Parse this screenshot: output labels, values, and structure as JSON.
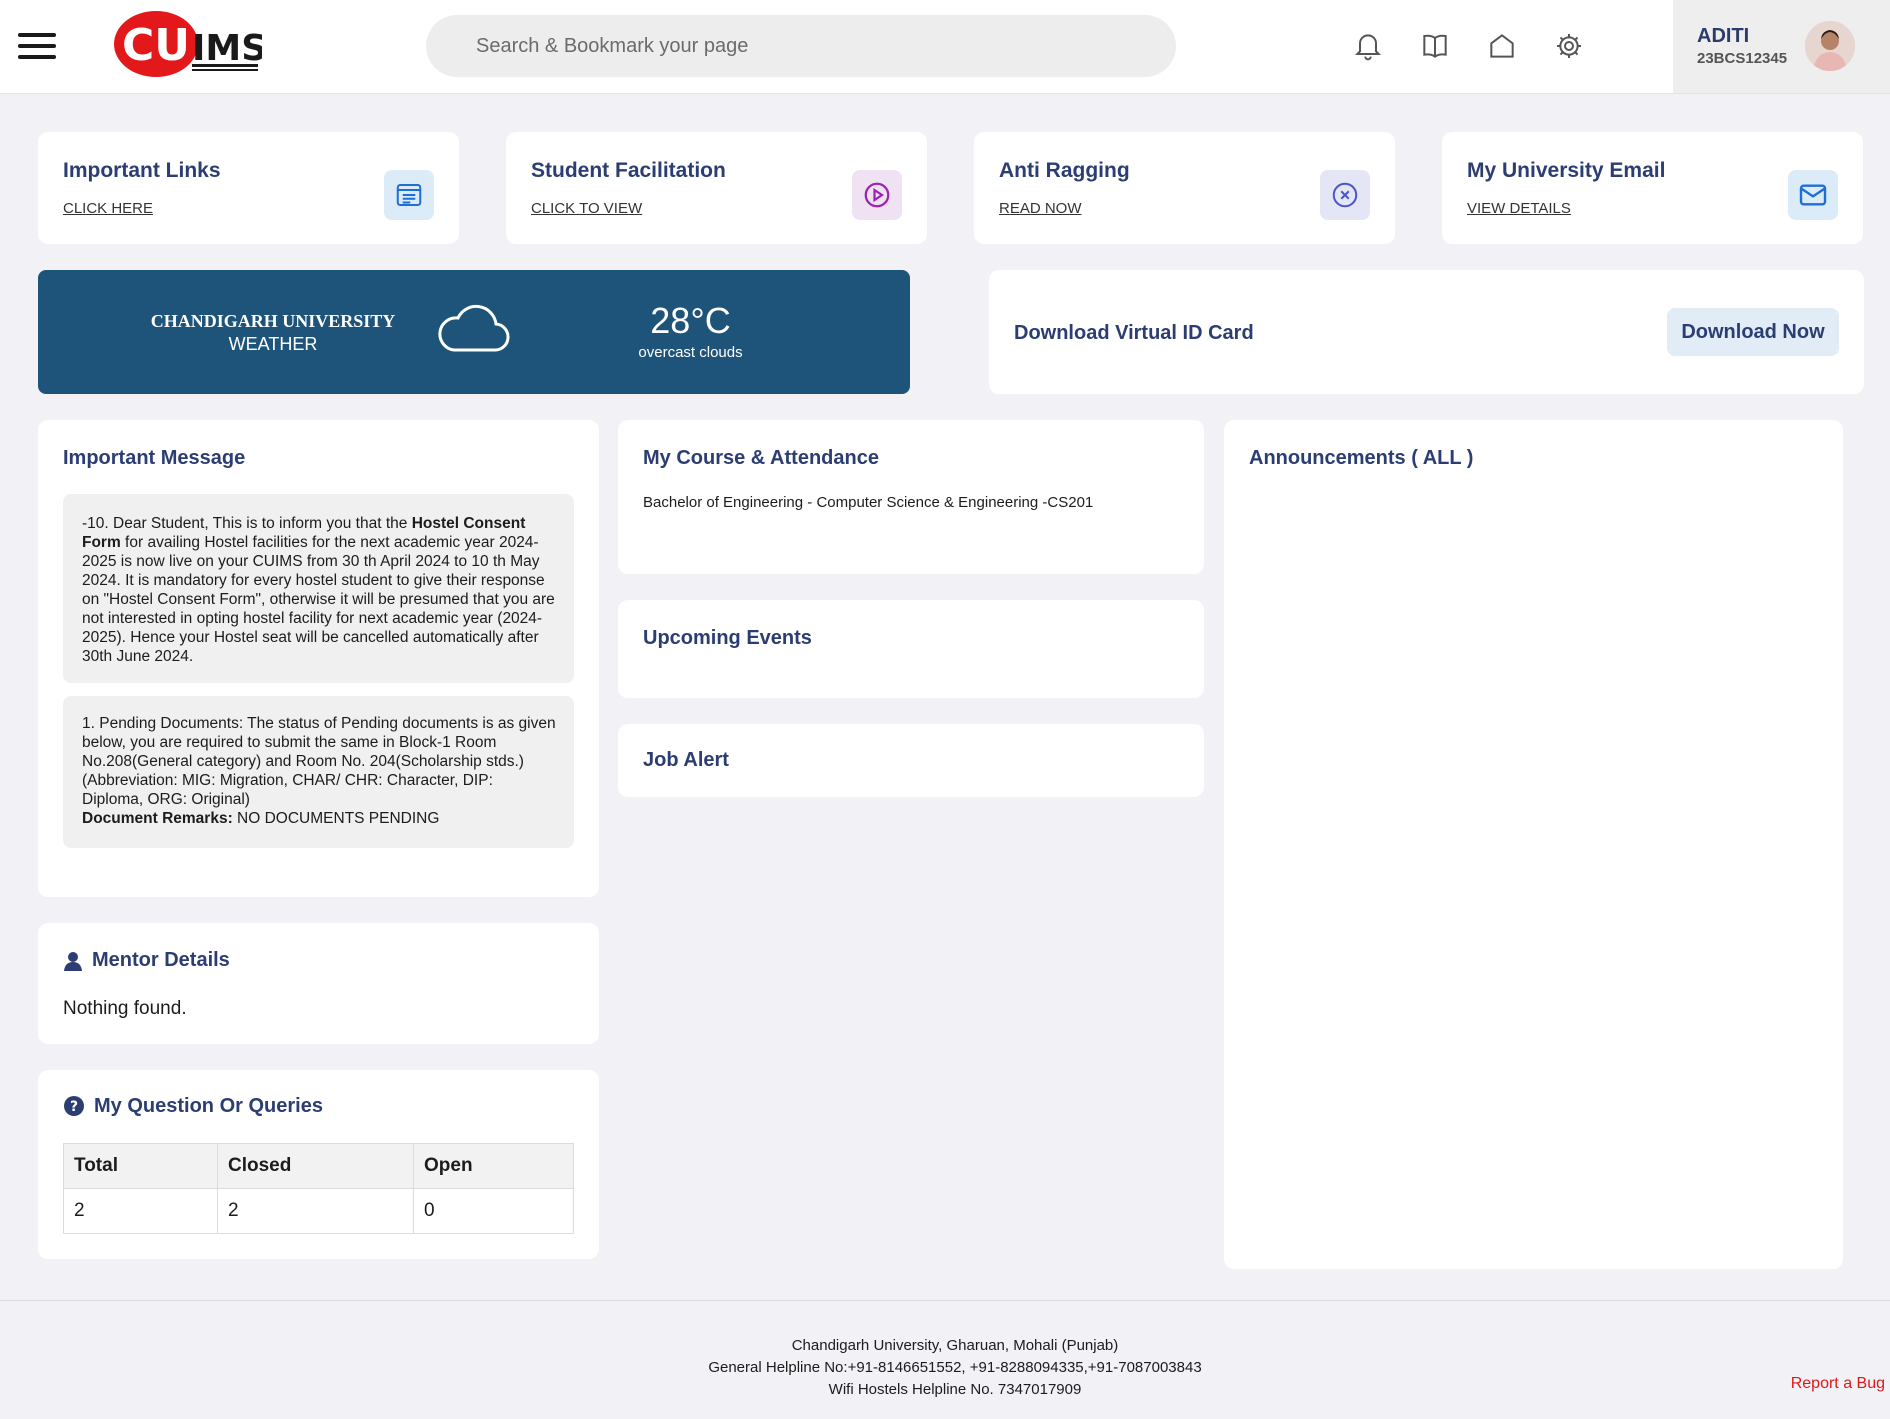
{
  "header": {
    "search_placeholder": "Search & Bookmark your page",
    "user": {
      "name": "ADITI",
      "id": "23BCS12345"
    },
    "icons": [
      "bell-icon",
      "book-icon",
      "home-icon",
      "gear-icon"
    ],
    "logo_text": "CUIMS"
  },
  "quick_links": [
    {
      "title": "Important Links",
      "action": "CLICK HERE",
      "icon": "browser-window-icon",
      "color": "#1d6fd6"
    },
    {
      "title": "Student Facilitation",
      "action": "CLICK TO VIEW",
      "icon": "play-circle-icon",
      "color": "#9d23b4"
    },
    {
      "title": "Anti Ragging",
      "action": "READ NOW",
      "icon": "close-circle-icon",
      "color": "#4a55c9"
    },
    {
      "title": "My University Email",
      "action": "VIEW DETAILS",
      "icon": "mail-icon",
      "color": "#1d6fd6"
    }
  ],
  "weather": {
    "title_line1": "CHANDIGARH UNIVERSITY",
    "title_line2": "WEATHER",
    "temperature": "28°C",
    "description": "overcast clouds"
  },
  "id_card": {
    "title": "Download Virtual ID Card",
    "button": "Download Now"
  },
  "important_message": {
    "title": "Important Message",
    "notice1": {
      "prefix": "-10. Dear Student, This is to inform you that the ",
      "bold": "Hostel Consent Form",
      "suffix": " for availing Hostel facilities for the next academic year 2024- 2025 is now live on your CUIMS from 30 th April 2024 to 10 th May 2024. It is mandatory for every hostel student to give their response on \"Hostel Consent Form\", otherwise it will be presumed that you are not interested in opting hostel facility for next academic year (2024- 2025). Hence your Hostel seat will be cancelled automatically after 30th June 2024."
    },
    "notice2": {
      "text": "1. Pending Documents: The status of Pending documents is as given below, you are required to submit the same in Block-1 Room No.208(General category) and Room No. 204(Scholarship stds.) (Abbreviation: MIG: Migration, CHAR/ CHR: Character, DIP: Diploma, ORG: Original)",
      "remarks_label": "Document Remarks:",
      "remarks_value": " NO DOCUMENTS PENDING"
    }
  },
  "mentor": {
    "title": "Mentor Details",
    "empty": "Nothing found."
  },
  "queries": {
    "title": "My Question Or Queries",
    "headers": [
      "Total",
      "Closed",
      "Open"
    ],
    "values": [
      "2",
      "2",
      "0"
    ]
  },
  "course": {
    "title": "My Course & Attendance",
    "line": "Bachelor of Engineering - Computer Science & Engineering -CS201"
  },
  "events": {
    "title": "Upcoming Events"
  },
  "jobs": {
    "title": "Job Alert"
  },
  "announcements": {
    "title": "Announcements ( ALL )"
  },
  "footer": {
    "line1": "Chandigarh University, Gharuan, Mohali (Punjab)",
    "line2": "General Helpline No:+91-8146651552, +91-8288094335,+91-7087003843",
    "line3": "Wifi Hostels Helpline No. 7347017909",
    "bug": "Report a Bug"
  },
  "colors": {
    "brand_navy": "#2b3d73",
    "weather_bg": "#1f547a",
    "logo_red": "#e2181b",
    "bug_red": "#e01818"
  }
}
